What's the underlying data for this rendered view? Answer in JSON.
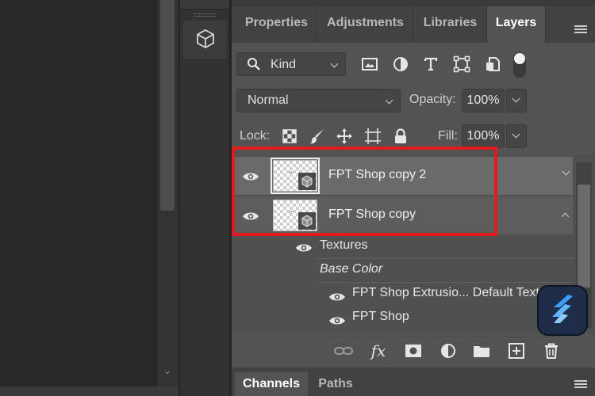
{
  "panel": {
    "tabs": [
      {
        "label": "Properties",
        "active": false
      },
      {
        "label": "Adjustments",
        "active": false
      },
      {
        "label": "Libraries",
        "active": false
      },
      {
        "label": "Layers",
        "active": true
      }
    ],
    "filter": {
      "kind_label": "Kind"
    },
    "blend_mode": "Normal",
    "opacity_label": "Opacity:",
    "opacity_value": "100%",
    "lock_label": "Lock:",
    "fill_label": "Fill:",
    "fill_value": "100%"
  },
  "layers": [
    {
      "name": "FPT Shop copy 2",
      "selected": true
    },
    {
      "name": "FPT Shop copy",
      "selected": false
    }
  ],
  "sublayers": {
    "textures_label": "Textures",
    "base_color_label": "Base Color",
    "items": [
      "FPT Shop Extrusio... Default Text",
      "FPT Shop"
    ]
  },
  "bottom_tabs": [
    {
      "label": "Channels",
      "active": true
    },
    {
      "label": "Paths",
      "active": false
    }
  ],
  "colors": {
    "highlight_box": "#e11c1c",
    "panel_bg": "#535353",
    "selected_row": "#6a6a6a",
    "app_badge": "#1f2d49",
    "app_badge_accent": "#3aa0ff"
  }
}
